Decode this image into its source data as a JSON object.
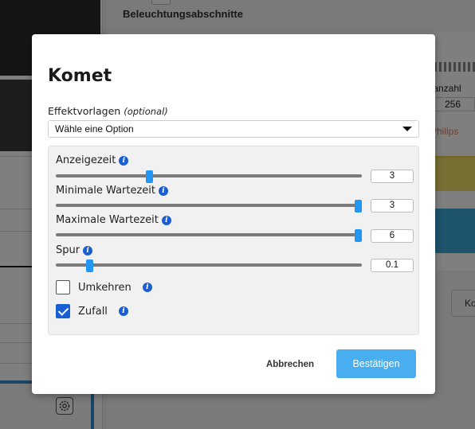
{
  "background": {
    "section_title": "Beleuchtungsabschnitte",
    "led_count_label": "tanzahl",
    "led_count_value": "256",
    "led_type": "Philips",
    "partial_button": "Ko"
  },
  "modal": {
    "title": "Komet",
    "preset": {
      "label": "Effektvorlagen",
      "optional_note": "(optional)",
      "selected": "Wähle eine Option"
    },
    "fields": {
      "display_time": {
        "label": "Anzeigezeit",
        "value": "3",
        "fraction": 0.3
      },
      "min_wait": {
        "label": "Minimale Wartezeit",
        "value": "3",
        "fraction": 1.0
      },
      "max_wait": {
        "label": "Maximale Wartezeit",
        "value": "6",
        "fraction": 1.0
      },
      "trail": {
        "label": "Spur",
        "value": "0.1",
        "fraction": 0.1
      }
    },
    "checkboxes": {
      "reverse": {
        "label": "Umkehren",
        "checked": false
      },
      "random": {
        "label": "Zufall",
        "checked": true
      }
    },
    "buttons": {
      "cancel": "Abbrechen",
      "confirm": "Bestätigen"
    }
  },
  "icons": {
    "info": "info-icon",
    "settings": "gear-icon",
    "dropdown": "chevron-down-icon"
  },
  "colors": {
    "accent": "#2196f3",
    "confirm": "#49aef0",
    "info": "#1a5fd1"
  }
}
